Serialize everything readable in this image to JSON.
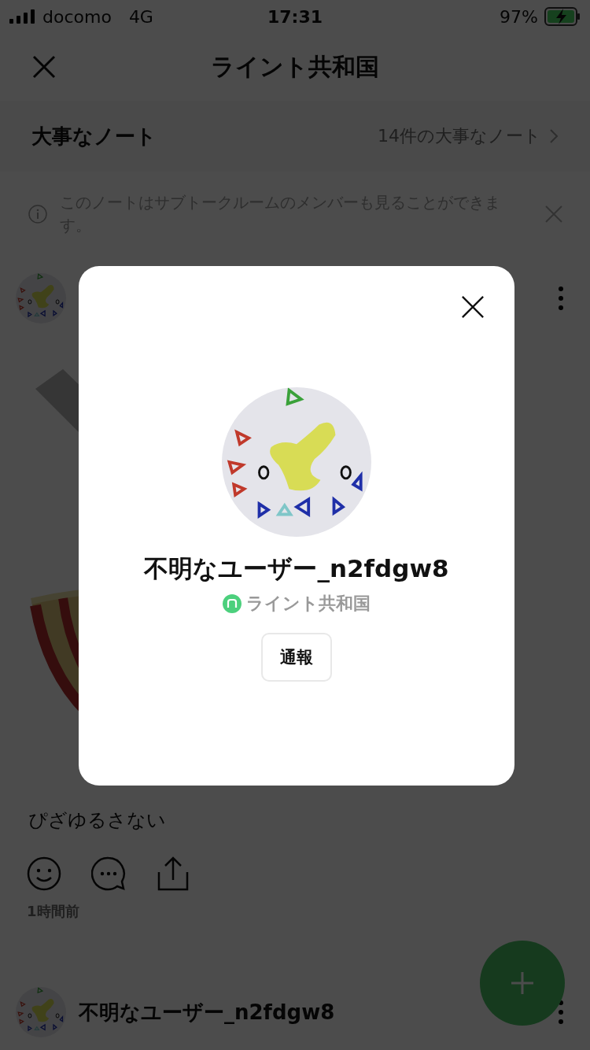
{
  "status_bar": {
    "carrier": "docomo",
    "network": "4G",
    "time": "17:31",
    "battery": "97%"
  },
  "header": {
    "title": "ライント共和国"
  },
  "pinned": {
    "title": "大事なノート",
    "link": "14件の大事なノート"
  },
  "notice": {
    "text": "このノートはサブトークルームのメンバーも見ることができます。"
  },
  "posts": [
    {
      "kind": "picture",
      "text": "ぴざゆるさない",
      "time": "1時間前"
    },
    {
      "kind": "author",
      "author": "不明なユーザー_n2fdgw8"
    }
  ],
  "modal": {
    "name": "不明なユーザー_n2fdgw8",
    "group": "ライント共和国",
    "report_button": "通報"
  }
}
